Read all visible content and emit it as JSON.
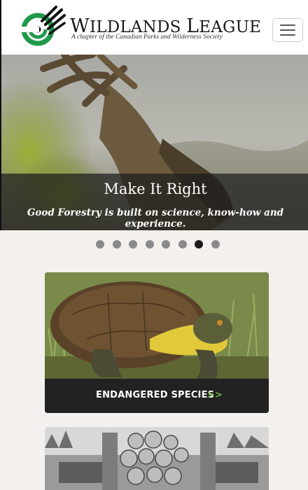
{
  "header": {
    "brand_name_first": "W",
    "brand_name_rest": "ILDLANDS ",
    "brand_name_first2": "L",
    "brand_name_rest2": "EAGUE",
    "tagline": "A chapter of the Canadian Parks and Wilderness Society"
  },
  "hero": {
    "title": "Make It Right",
    "text": "Good Forestry is built on science, know-how and experience."
  },
  "carousel": {
    "total_slides": 8,
    "active_index": 6
  },
  "cards": [
    {
      "label": "ENDANGERED SPECIES",
      "arrows": ">>"
    }
  ],
  "colors": {
    "accent_green": "#6ab43a",
    "logo_green": "#1f9a4b",
    "caption_bg": "#1c1c1c",
    "card_bar": "#222222"
  }
}
